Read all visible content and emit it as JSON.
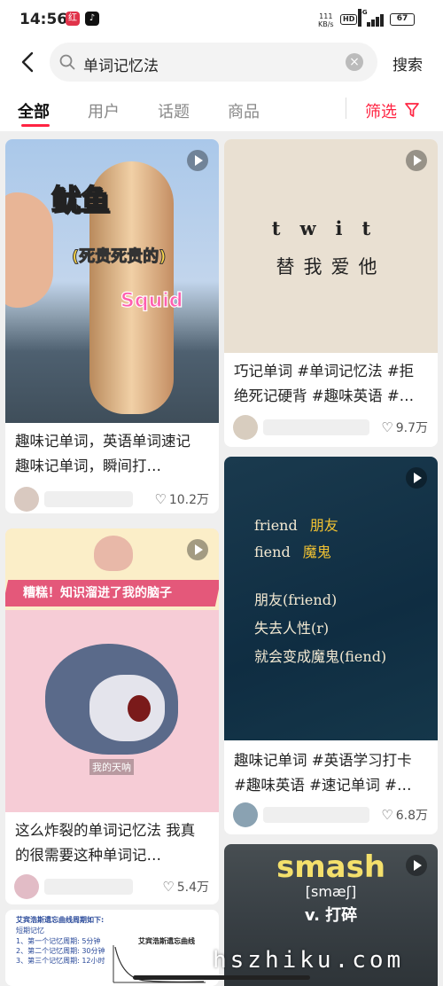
{
  "status_bar": {
    "time": "14:56",
    "app_a": "红",
    "app_b": "♪",
    "net_speed_value": "111",
    "net_speed_unit": "KB/s",
    "hd": "HD",
    "network": "5G",
    "battery": "67"
  },
  "search": {
    "query": "单词记忆法",
    "button": "搜索"
  },
  "tabs": [
    {
      "label": "全部"
    },
    {
      "label": "用户"
    },
    {
      "label": "话题"
    },
    {
      "label": "商品"
    }
  ],
  "filter": {
    "label": "筛选"
  },
  "colors": {
    "accent": "#ff2442"
  },
  "cards": [
    {
      "title": "趣味记单词，英语单词速记 趣味记单词，瞬间打…",
      "likes": "10.2万",
      "is_video": true,
      "media": {
        "title": "鱿鱼",
        "subtitle": "(死贵死贵的)",
        "en": "Squid"
      }
    },
    {
      "title": "巧记单词 #单词记忆法 #拒绝死记硬背 #趣味英语 #…",
      "likes": "9.7万",
      "is_video": true,
      "media": {
        "en": "twit",
        "zh": "替我爱他"
      }
    },
    {
      "title": "趣味记单词 #英语学习打卡 #趣味英语 #速记单词 #…",
      "likes": "6.8万",
      "is_video": true,
      "media": {
        "lines": [
          {
            "en": "friend",
            "zh": "朋友"
          },
          {
            "en": "fiend",
            "zh": "魔鬼"
          }
        ],
        "story": [
          "朋友(friend)",
          "失去人性(r)",
          "就会变成魔鬼(fiend)"
        ]
      }
    },
    {
      "title": "这么炸裂的单词记忆法 我真的很需要这种单词记…",
      "likes": "5.4万",
      "is_video": true,
      "media": {
        "banner": "糟糕！知识溜进了我的脑子",
        "caption": "我的天呐"
      }
    },
    {
      "is_video": true,
      "media": {
        "word": "smash",
        "ipa": "[smæʃ]",
        "pos": "v. 打碎"
      }
    },
    {
      "media": {
        "title": "艾宾浩斯遗忘曲线周期如下:",
        "subtitle": "短期记忆",
        "lines": [
          "1、第一个记忆周期: 5分钟",
          "2、第二个记忆周期: 30分钟",
          "3、第三个记忆周期: 12小时"
        ],
        "chart_label": "艾宾浩斯遗忘曲线"
      }
    }
  ],
  "watermark": "hszhiku.com"
}
